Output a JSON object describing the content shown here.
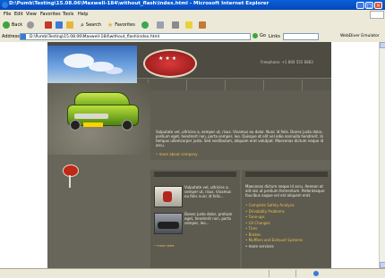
{
  "window": {
    "title": "D:\\Pumb\\Testing\\15.08.06\\Maxwell-184\\without_flash\\index.html - Microsoft Internet Explorer"
  },
  "menu": [
    "File",
    "Edit",
    "View",
    "Favorites",
    "Tools",
    "Help"
  ],
  "toolbar": {
    "back": "Back",
    "search": "Search",
    "favorites": "Favorites"
  },
  "address": {
    "label": "Address",
    "value": "D:\\Pumb\\Testing\\15.08.06\\Maxwell-184\\without_flash\\index.html",
    "go": "Go",
    "links": "Links",
    "extra": "WebDiver Emulator"
  },
  "site": {
    "phone": "Freephone: +1 800 555 6883",
    "intro": "Vulputate vel, ultricies a, semper ut, risus. Vivamus eu dolor. Nunc id felis. Donec justo dolor, pretium eget, hendrerit non, porta semper, leo. Quisque at elit vel odio nonnulla hendrerit. In tempus ullamcorper justo. Sed vestibulum, aliquam erat volutpat. Maecenas dictum neque id arcu.",
    "more_about": "more about company",
    "news": [
      {
        "text": "Vulputate vel, ultricies a, semper ut, risus. Vivamus eu felis nunc id felis..."
      },
      {
        "text": "Donec justo dolor, pretium eget, hendrerit non, porta semper, leo..."
      }
    ],
    "more_news": "more news",
    "services_intro": "Maecenas dictum neque id arcu. Aenean at elit nisi ut pretium fermentum. Pellentesque faucibus augue vel est aliquam erat.",
    "services": [
      "Complete Safety Analysis",
      "Drivability Problems",
      "Tune-ups",
      "Oil Changes",
      "Tires",
      "Brakes",
      "Mufflers and Exhaust Systems"
    ],
    "more_services": "more services"
  }
}
